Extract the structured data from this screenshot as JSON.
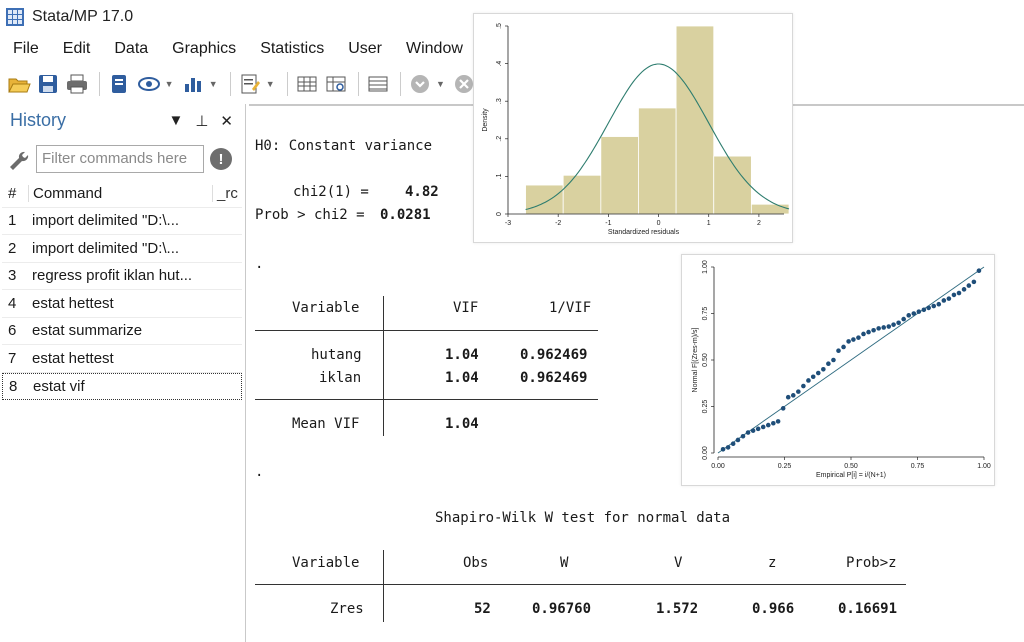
{
  "window": {
    "title": "Stata/MP 17.0"
  },
  "menu": [
    "File",
    "Edit",
    "Data",
    "Graphics",
    "Statistics",
    "User",
    "Window"
  ],
  "toolbar": {
    "icons": [
      "open-icon",
      "save-icon",
      "print-icon",
      "log-icon",
      "viewer-icon",
      "graph-icon",
      "do-file-editor-icon",
      "data-editor-icon",
      "data-browser-icon",
      "variables-manager-icon",
      "more-icon",
      "break-icon"
    ]
  },
  "history": {
    "title": "History",
    "filter_placeholder": "Filter commands here",
    "col_num": "#",
    "col_command": "Command",
    "col_rc": "_rc",
    "rows": [
      {
        "num": "1",
        "command": "import delimited \"D:\\..."
      },
      {
        "num": "2",
        "command": "import delimited \"D:\\..."
      },
      {
        "num": "3",
        "command": "regress profit iklan hut..."
      },
      {
        "num": "4",
        "command": "estat hettest"
      },
      {
        "num": "6",
        "command": "estat summarize"
      },
      {
        "num": "7",
        "command": "estat hettest"
      },
      {
        "num": "8",
        "command": "estat vif"
      }
    ]
  },
  "results": {
    "h0": "H0: Constant variance",
    "chi2_label": "chi2(1) =",
    "chi2_value": "4.82",
    "prob_label": "Prob > chi2 =",
    "prob_value": "0.0281",
    "dot1": ".",
    "vif": {
      "col_variable": "Variable",
      "col_vif": "VIF",
      "col_invvif": "1/VIF",
      "rows": [
        {
          "variable": "hutang",
          "vif": "1.04",
          "invvif": "0.962469"
        },
        {
          "variable": "iklan",
          "vif": "1.04",
          "invvif": "0.962469"
        }
      ],
      "mean_label": "Mean VIF",
      "mean_value": "1.04"
    },
    "dot2": ".",
    "sw": {
      "title": "Shapiro-Wilk W test for normal data",
      "col_variable": "Variable",
      "col_obs": "Obs",
      "col_w": "W",
      "col_v": "V",
      "col_z": "z",
      "col_prob": "Prob>z",
      "row": {
        "variable": "Zres",
        "obs": "52",
        "w": "0.96760",
        "v": "1.572",
        "z": "0.966",
        "prob": "0.16691"
      }
    }
  },
  "chart_data": [
    {
      "type": "bar",
      "subtype": "histogram-with-normal-curve",
      "xlabel": "Standardized residuals",
      "ylabel": "Density",
      "bins": [
        {
          "from": -2.65,
          "to": -1.9,
          "density": 0.077
        },
        {
          "from": -1.9,
          "to": -1.15,
          "density": 0.103
        },
        {
          "from": -1.15,
          "to": -0.4,
          "density": 0.206
        },
        {
          "from": -0.4,
          "to": 0.35,
          "density": 0.282
        },
        {
          "from": 0.35,
          "to": 1.1,
          "density": 0.5
        },
        {
          "from": 1.1,
          "to": 1.85,
          "density": 0.154
        },
        {
          "from": 1.85,
          "to": 2.6,
          "density": 0.026
        }
      ],
      "normal_curve": {
        "mean": 0,
        "sd": 1
      },
      "xlim": [
        -3,
        2.5
      ],
      "ylim": [
        0,
        0.5
      ],
      "x_ticks": [
        "-3",
        "-2",
        "-1",
        "0",
        "1",
        "2"
      ],
      "y_ticks": [
        "0",
        ".1",
        ".2",
        ".3",
        ".4",
        ".5"
      ],
      "colors": {
        "bar": "#d9d1a0",
        "bar_stroke": "#ffffff",
        "curve": "#2e7d6f"
      }
    },
    {
      "type": "scatter",
      "subtype": "standardized-normal-probability-plot",
      "xlabel": "Empirical P[i] = i/(N+1)",
      "ylabel": "Normal F[(Zres-m)/s]",
      "xlim": [
        0,
        1
      ],
      "ylim": [
        0,
        1
      ],
      "x_ticks": [
        "0.00",
        "0.25",
        "0.50",
        "0.75",
        "1.00"
      ],
      "y_ticks": [
        "0.00",
        "0.25",
        "0.50",
        "0.75",
        "1.00"
      ],
      "points_x": [
        0.019,
        0.038,
        0.057,
        0.075,
        0.094,
        0.113,
        0.132,
        0.151,
        0.17,
        0.189,
        0.208,
        0.226,
        0.245,
        0.264,
        0.283,
        0.302,
        0.321,
        0.34,
        0.358,
        0.377,
        0.396,
        0.415,
        0.434,
        0.453,
        0.472,
        0.491,
        0.509,
        0.528,
        0.547,
        0.566,
        0.585,
        0.604,
        0.623,
        0.642,
        0.66,
        0.679,
        0.698,
        0.717,
        0.736,
        0.755,
        0.774,
        0.792,
        0.811,
        0.83,
        0.849,
        0.868,
        0.887,
        0.906,
        0.925,
        0.943,
        0.962,
        0.981
      ],
      "points_y": [
        0.02,
        0.03,
        0.05,
        0.07,
        0.09,
        0.11,
        0.12,
        0.13,
        0.14,
        0.15,
        0.16,
        0.17,
        0.24,
        0.3,
        0.31,
        0.33,
        0.36,
        0.39,
        0.41,
        0.43,
        0.45,
        0.48,
        0.5,
        0.55,
        0.57,
        0.6,
        0.61,
        0.62,
        0.64,
        0.65,
        0.66,
        0.67,
        0.675,
        0.68,
        0.69,
        0.7,
        0.72,
        0.74,
        0.75,
        0.76,
        0.77,
        0.78,
        0.79,
        0.8,
        0.82,
        0.83,
        0.85,
        0.86,
        0.88,
        0.9,
        0.92,
        0.98
      ],
      "reference_line": "diagonal",
      "colors": {
        "marker": "#1f4e79",
        "line": "#2e6b80"
      }
    }
  ]
}
